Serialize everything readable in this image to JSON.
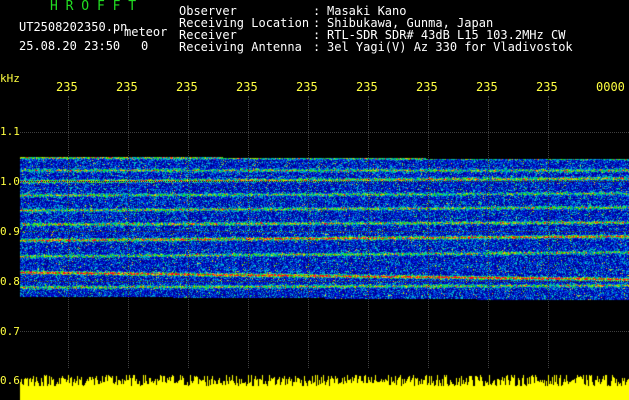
{
  "header": {
    "logo": "H R O F F T",
    "filename": "UT2508202350.pn",
    "meteor_label": "meteor",
    "datetime": "25.08.20 23:50",
    "counter": "0",
    "info_labels": [
      "Observer",
      "Receiving Location",
      "Receiver",
      "Receiving Antenna"
    ],
    "info_sep": ":",
    "info_values": [
      "Masaki Kano",
      "Shibukawa, Gunma, Japan",
      "RTL-SDR SDR# 43dB L15 103.2MHz CW",
      "3el Yagi(V) Az 330 for Vladivostok"
    ]
  },
  "axes": {
    "y_unit": "kHz",
    "y_ticks": [
      "1.1",
      "1.0",
      "0.9",
      "0.8",
      "0.7",
      "0.6"
    ],
    "x_ticks": [
      "235",
      "235",
      "235",
      "235",
      "235",
      "235",
      "235",
      "235",
      "235",
      "0000"
    ]
  },
  "colors": {
    "background": "#000000",
    "text_white": "#ffffff",
    "text_yellow": "#ffff40",
    "logo_green": "#22dd22",
    "noise_floor": "#0000aa",
    "signal_hot": "#ff2020",
    "meteor_bar": "#ffff00"
  }
}
